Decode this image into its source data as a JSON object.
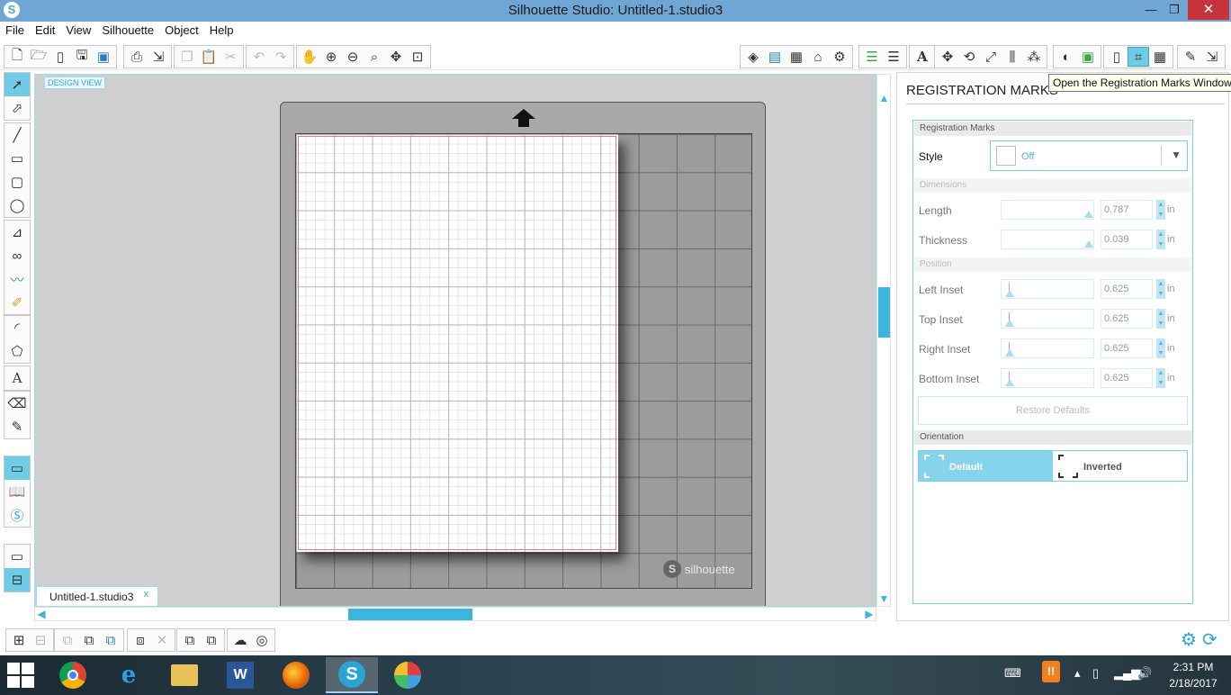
{
  "window": {
    "title": "Silhouette Studio: Untitled-1.studio3",
    "logo_letter": "S",
    "minimize": "—",
    "maximize": "❐",
    "close": "✕"
  },
  "menu": [
    "File",
    "Edit",
    "View",
    "Silhouette",
    "Object",
    "Help"
  ],
  "canvas": {
    "design_view_label": "DESIGN VIEW",
    "mat_brand": "silhouette",
    "mat_brand_logo": "S",
    "doc_tab": "Untitled-1.studio3",
    "doc_tab_close": "x"
  },
  "tooltip": "Open the Registration Marks Window",
  "registration_panel": {
    "title": "REGISTRATION MARKS",
    "section_title": "Registration Marks",
    "style_label": "Style",
    "style_value": "Off",
    "dimensions_header": "Dimensions",
    "length_label": "Length",
    "length_value": "0.787",
    "thickness_label": "Thickness",
    "thickness_value": "0.039",
    "position_header": "Position",
    "left_inset_label": "Left Inset",
    "left_inset_value": "0.625",
    "top_inset_label": "Top Inset",
    "top_inset_value": "0.625",
    "right_inset_label": "Right Inset",
    "right_inset_value": "0.625",
    "bottom_inset_label": "Bottom Inset",
    "bottom_inset_value": "0.625",
    "unit": "in",
    "restore_defaults": "Restore Defaults",
    "orientation_header": "Orientation",
    "orientation_default": "Default",
    "orientation_inverted": "Inverted",
    "selected_orientation": "Default"
  },
  "taskbar": {
    "time": "2:31 PM",
    "date": "2/18/2017"
  },
  "colors": {
    "accent": "#3db6dc",
    "titlebar": "#6fa6d4",
    "close_button": "#c7333b",
    "selected_option": "#86d3ec"
  }
}
